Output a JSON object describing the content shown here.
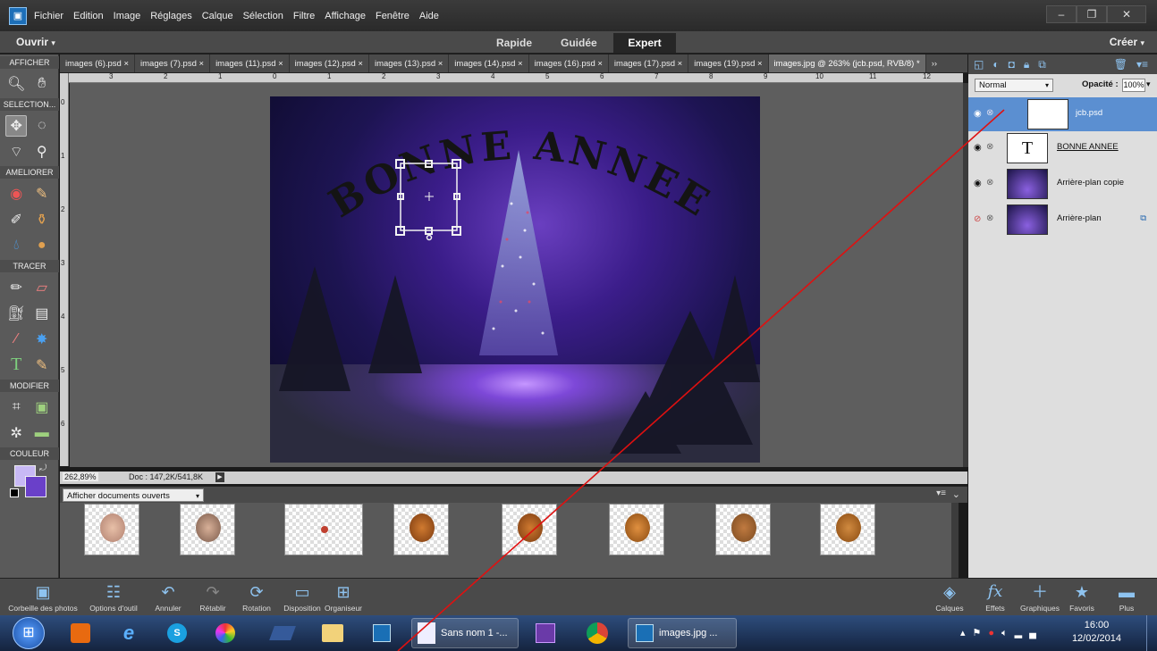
{
  "menubar": {
    "items": [
      "Fichier",
      "Edition",
      "Image",
      "Réglages",
      "Calque",
      "Sélection",
      "Filtre",
      "Affichage",
      "Fenêtre",
      "Aide"
    ]
  },
  "modebar": {
    "ouvrir": "Ouvrir",
    "modes": [
      "Rapide",
      "Guidée",
      "Expert"
    ],
    "active_mode": "Expert",
    "creer": "Créer"
  },
  "toolbox": {
    "sections": {
      "afficher": "AFFICHER",
      "selection": "SELECTION...",
      "ameliorer": "AMELIORER",
      "tracer": "TRACER",
      "modifier": "MODIFIER",
      "couleur": "COULEUR"
    },
    "colors": {
      "foreground": "#c8b9f5",
      "background": "#6a40c9"
    }
  },
  "doc_tabs": [
    "images (6).psd ×",
    "images (7).psd ×",
    "images (11).psd ×",
    "images (12).psd ×",
    "images (13).psd ×",
    "images (14).psd ×",
    "images (16).psd ×",
    "images (17).psd ×",
    "images (19).psd ×",
    "images.jpg @ 263% (jcb.psd, RVB/8) *"
  ],
  "ruler_top": [
    "3",
    "2",
    "1",
    "0",
    "1",
    "2",
    "3",
    "4",
    "5",
    "6",
    "7",
    "8",
    "9",
    "10",
    "11",
    "12"
  ],
  "ruler_left": [
    "0",
    "1",
    "2",
    "3",
    "4",
    "5",
    "6"
  ],
  "artwork": {
    "text": "BONNE ANNEE"
  },
  "status": {
    "zoom": "262,89%",
    "doc": "Doc : 147,2K/541,8K"
  },
  "bin": {
    "filter": "Afficher documents ouverts"
  },
  "layers_panel": {
    "blend_mode": "Normal",
    "opacity_label": "Opacité :",
    "opacity": "100%",
    "layers": [
      {
        "name": "jcb.psd",
        "active": true,
        "visible": true
      },
      {
        "name": "BONNE ANNEE",
        "active": false,
        "visible": true
      },
      {
        "name": "Arrière-plan copie",
        "active": false,
        "visible": true
      },
      {
        "name": "Arrière-plan",
        "active": false,
        "visible": false
      }
    ]
  },
  "bottom_left": [
    {
      "label": "Corbeille des photos",
      "icon": "photo-bin-icon"
    },
    {
      "label": "Options d'outil",
      "icon": "tool-options-icon"
    },
    {
      "label": "Annuler",
      "icon": "undo-icon"
    },
    {
      "label": "Rétablir",
      "icon": "redo-icon"
    },
    {
      "label": "Rotation",
      "icon": "rotate-icon"
    },
    {
      "label": "Disposition",
      "icon": "layout-icon"
    },
    {
      "label": "Organiseur",
      "icon": "organizer-icon"
    }
  ],
  "bottom_right": [
    {
      "label": "Calques",
      "icon": "layers-icon"
    },
    {
      "label": "Effets",
      "icon": "effects-icon"
    },
    {
      "label": "Graphiques",
      "icon": "graphics-icon"
    },
    {
      "label": "Favoris",
      "icon": "favorites-icon"
    },
    {
      "label": "Plus",
      "icon": "more-icon"
    }
  ],
  "taskbar": {
    "apps": [
      {
        "label": "",
        "icon": "media-icon"
      },
      {
        "label": "",
        "icon": "ie-icon"
      },
      {
        "label": "",
        "icon": "skype-icon"
      },
      {
        "label": "",
        "icon": "picasa-icon"
      },
      {
        "label": "",
        "icon": "book-icon"
      },
      {
        "label": "",
        "icon": "folder-icon"
      },
      {
        "label": "",
        "icon": "elements-icon"
      },
      {
        "label": "Sans nom 1 -...",
        "icon": "document-icon"
      },
      {
        "label": "",
        "icon": "premiere-icon"
      },
      {
        "label": "",
        "icon": "chrome-icon"
      },
      {
        "label": "images.jpg ...",
        "icon": "photoshop-icon"
      }
    ],
    "time": "16:00",
    "date": "12/02/2014"
  }
}
